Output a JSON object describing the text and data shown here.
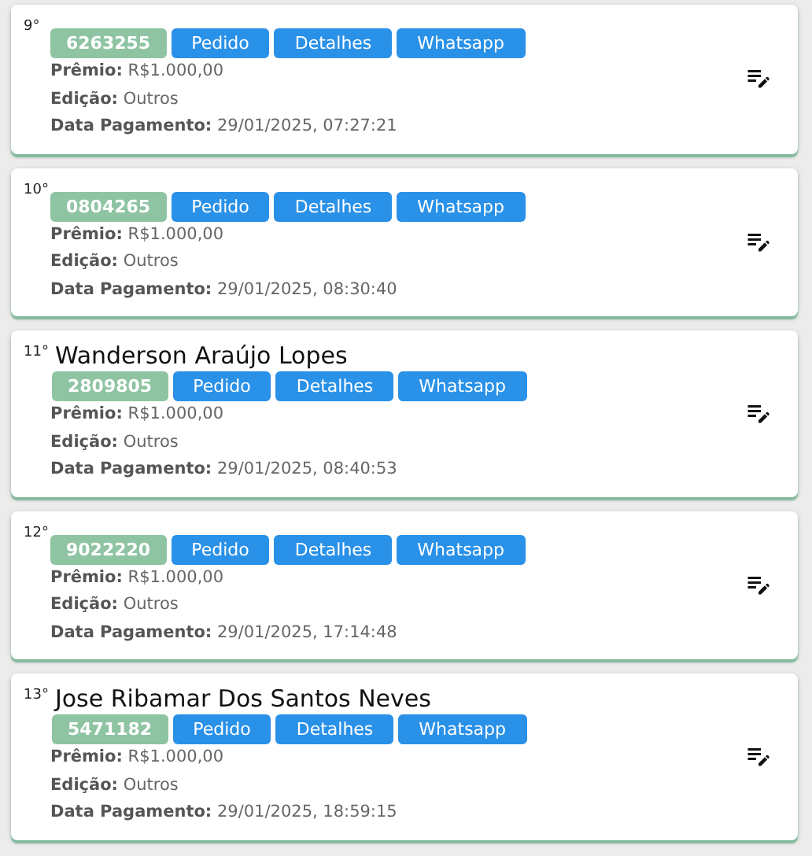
{
  "entries": [
    {
      "rank": "9°",
      "code": "6263255",
      "buttons": [
        "Pedido",
        "Detalhes",
        "Whatsapp"
      ],
      "details": [
        "**Prêmio:** R$1.000,00",
        "**Edição:** Outros",
        "**Data Pagamento:** 29/01/2025, 07:27:21"
      ]
    },
    {
      "rank": "10°",
      "code": "0804265",
      "buttons": [
        "Pedido",
        "Detalhes",
        "Whatsapp"
      ],
      "details": [
        "**Prêmio:** R$1.000,00",
        "**Edição:** Outros",
        "**Data Pagamento:** 29/01/2025, 08:30:40"
      ]
    },
    {
      "rank": "11°",
      "name": "Wanderson Araújo Lopes",
      "code": "2809805",
      "buttons": [
        "Pedido",
        "Detalhes",
        "Whatsapp"
      ],
      "details": [
        "**Prêmio:** R$1.000,00",
        "**Edição:** Outros",
        "**Data Pagamento:** 29/01/2025, 08:40:53"
      ]
    },
    {
      "rank": "12°",
      "code": "9022220",
      "buttons": [
        "Pedido",
        "Detalhes",
        "Whatsapp"
      ],
      "details": [
        "**Prêmio:** R$1.000,00",
        "**Edição:** Outros",
        "**Data Pagamento:** 29/01/2025, 17:14:48"
      ]
    },
    {
      "rank": "13°",
      "name": "Jose Ribamar Dos Santos Neves",
      "code": "5471182",
      "buttons": [
        "Pedido",
        "Detalhes",
        "Whatsapp"
      ],
      "details": [
        "**Prêmio:** R$1.000,00",
        "**Edição:** Outros",
        "**Data Pagamento:** 29/01/2025, 18:59:15"
      ]
    }
  ]
}
